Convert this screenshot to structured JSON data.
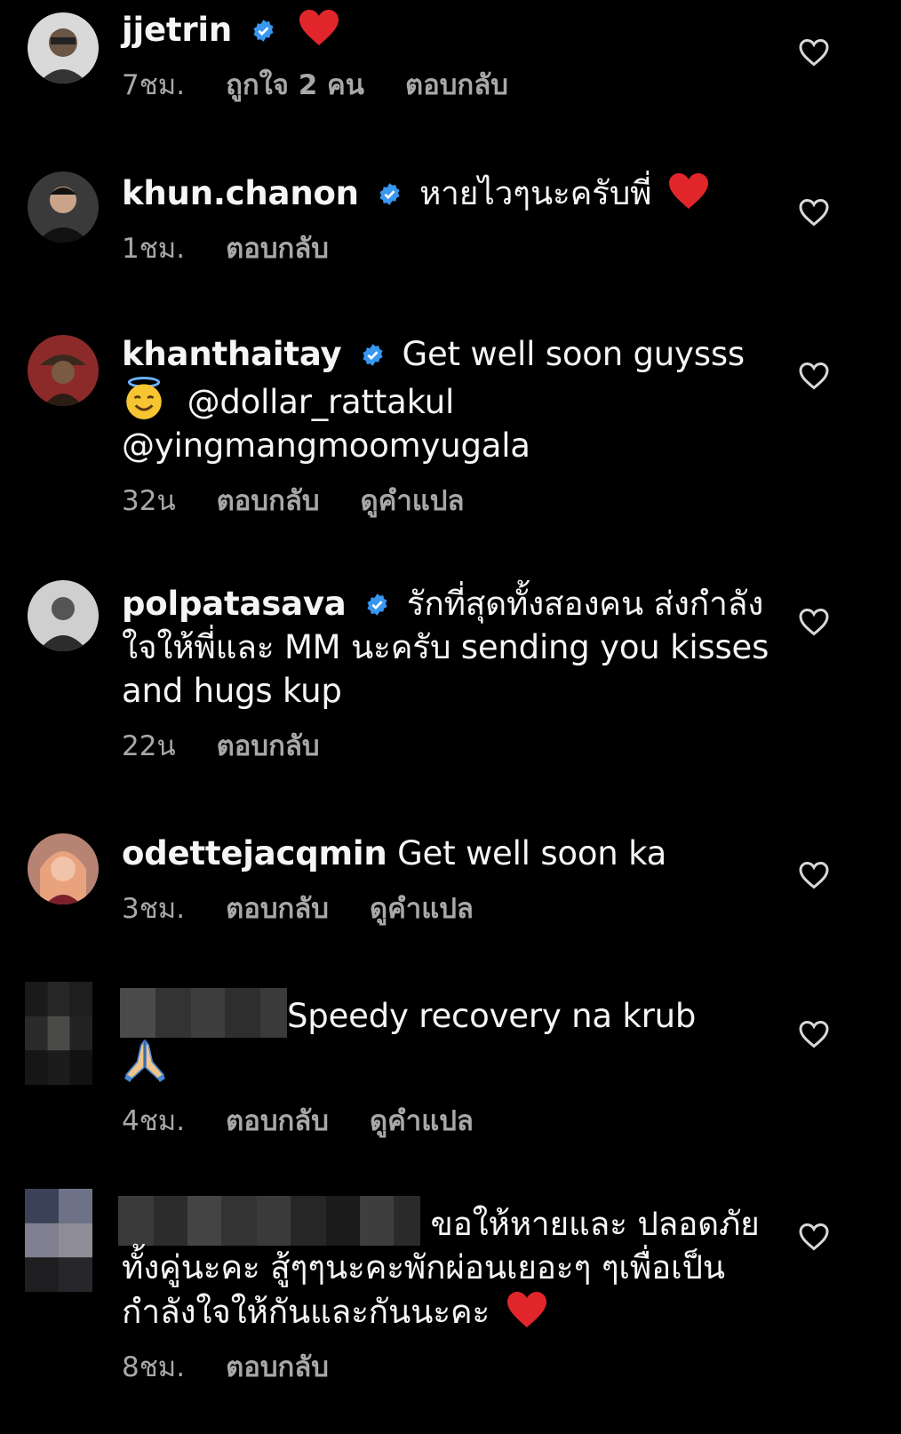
{
  "reply_label": "ตอบกลับ",
  "translate_label": "ดูคำแปล",
  "comments": [
    {
      "username": "jjetrin",
      "text": "",
      "time": "7ชม.",
      "likes": "ถูกใจ 2 คน"
    },
    {
      "username": "khun.chanon",
      "text": "หายไวๆนะครับพี่",
      "time": "1ชม."
    },
    {
      "username": "khanthaitay",
      "text": "Get well soon guysss",
      "mention1": "@dollar_rattakul",
      "mention2": "@yingmangmoomyugala",
      "time": "32น"
    },
    {
      "username": "polpatasava",
      "text": "รักที่สุดทั้งสองคน ส่งกำลังใจให้พี่และ MM นะครับ sending you kisses and hugs kup",
      "time": "22น"
    },
    {
      "username": "odettejacqmin",
      "text": "Get well soon ka",
      "time": "3ชม."
    },
    {
      "username": "",
      "text": "Speedy recovery na krub",
      "time": "4ชม."
    },
    {
      "username": "",
      "text": " ขอให้หายและ ปลอดภัยทั้งคู่นะคะ สู้ๆๆนะคะพักผ่อนเยอะๆ ๆเพื่อเป็นกำลังใจให้กันและกันนะคะ",
      "time": "8ชม."
    }
  ],
  "colors": {
    "background": "#000000",
    "meta": "#a8a8a8",
    "verified": "#3897f0",
    "heart": "#e0262b"
  }
}
